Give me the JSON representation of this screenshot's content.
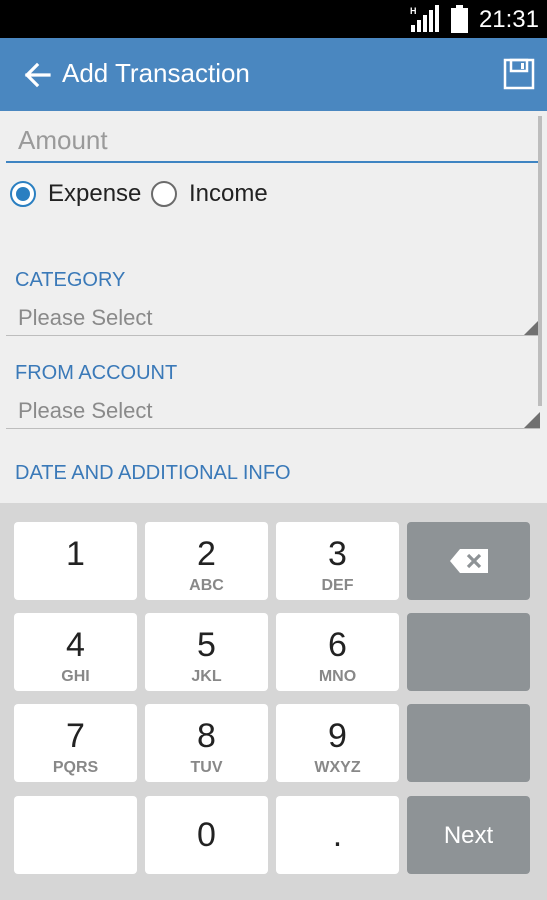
{
  "status_bar": {
    "time": "21:31",
    "signal_icon": "signal-icon",
    "battery_icon": "battery-icon"
  },
  "app_bar": {
    "title": "Add Transaction",
    "back_icon": "arrow-left-icon",
    "save_icon": "save-icon"
  },
  "form": {
    "amount_placeholder": "Amount",
    "type_options": [
      {
        "label": "Expense",
        "selected": true
      },
      {
        "label": "Income",
        "selected": false
      }
    ],
    "category": {
      "label": "CATEGORY",
      "value": "Please Select"
    },
    "from_account": {
      "label": "FROM ACCOUNT",
      "value": "Please Select"
    },
    "date_info_label": "DATE AND ADDITIONAL INFO"
  },
  "keypad": {
    "keys": [
      {
        "digit": "1",
        "letters": ""
      },
      {
        "digit": "2",
        "letters": "ABC"
      },
      {
        "digit": "3",
        "letters": "DEF"
      },
      {
        "digit": "4",
        "letters": "GHI"
      },
      {
        "digit": "5",
        "letters": "JKL"
      },
      {
        "digit": "6",
        "letters": "MNO"
      },
      {
        "digit": "7",
        "letters": "PQRS"
      },
      {
        "digit": "8",
        "letters": "TUV"
      },
      {
        "digit": "9",
        "letters": "WXYZ"
      },
      {
        "digit": "0",
        "letters": ""
      },
      {
        "digit": ".",
        "letters": ""
      }
    ],
    "next_label": "Next",
    "backspace_icon": "backspace-icon"
  },
  "colors": {
    "app_bar": "#4a87c0",
    "accent": "#3a79b8",
    "keypad_bg": "#d6d6d6",
    "function_key": "#8e9396"
  }
}
